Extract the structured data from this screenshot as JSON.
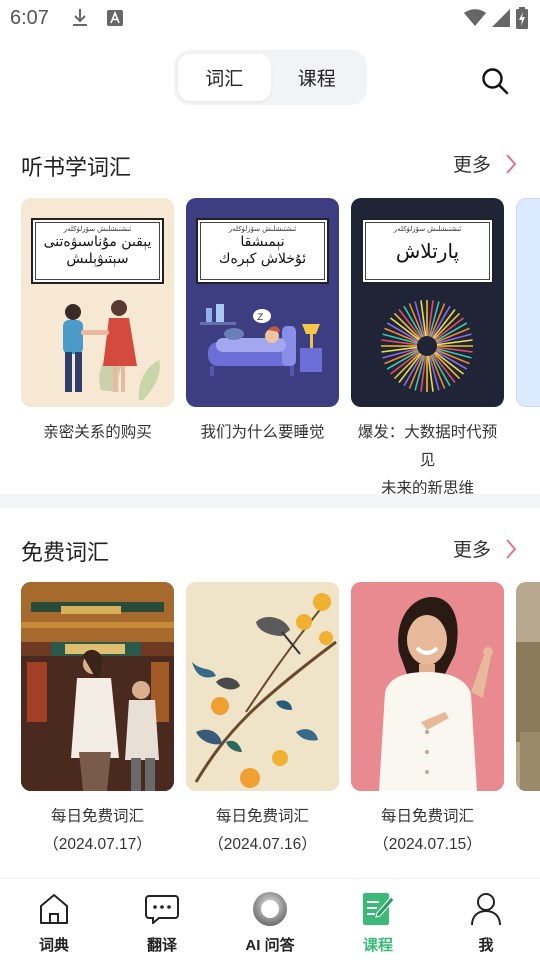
{
  "status_bar": {
    "time": "6:07"
  },
  "top_tabs": [
    {
      "label": "词汇",
      "active": true
    },
    {
      "label": "课程",
      "active": false
    }
  ],
  "sections": [
    {
      "title": "听书学词汇",
      "more": "更多",
      "cards": [
        {
          "caption_line1": "亲密关系的购买",
          "caption_line2": "",
          "cover_small": "ئىشتىشلىش سۆزلۈكلەر",
          "cover_title_1": "يېقىن مۇناسىۋەتنى",
          "cover_title_2": "سېتىۋېلىش"
        },
        {
          "caption_line1": "我们为什么要睡觉",
          "caption_line2": "",
          "cover_small": "ئىشتىشلىش سۆزلۈكلەر",
          "cover_title_1": "نېمىشقا",
          "cover_title_2": "ئۇخلاش كېرەك"
        },
        {
          "caption_line1": "爆发：大数据时代预见",
          "caption_line2": "未来的新思维",
          "cover_small": "ئىشتىشلىش سۆزلۈكلەر",
          "cover_title_1": "پارتلاش",
          "cover_title_2": ""
        }
      ]
    },
    {
      "title": "免费词汇",
      "more": "更多",
      "cards": [
        {
          "caption_line1": "每日免费词汇",
          "caption_line2": "（2024.07.17）"
        },
        {
          "caption_line1": "每日免费词汇",
          "caption_line2": "（2024.07.16）"
        },
        {
          "caption_line1": "每日免费词汇",
          "caption_line2": "（2024.07.15）"
        }
      ]
    }
  ],
  "bottom_nav": [
    {
      "label": "词典",
      "icon": "house-icon",
      "active": false
    },
    {
      "label": "翻译",
      "icon": "chat-bubble-icon",
      "active": false
    },
    {
      "label": "AI 问答",
      "icon": "ai-ring-icon",
      "active": false
    },
    {
      "label": "课程",
      "icon": "notebook-pen-icon",
      "active": true
    },
    {
      "label": "我",
      "icon": "person-icon",
      "active": false
    }
  ],
  "colors": {
    "accent_green": "#3cb878",
    "chevron_pink": "#e0768e"
  }
}
